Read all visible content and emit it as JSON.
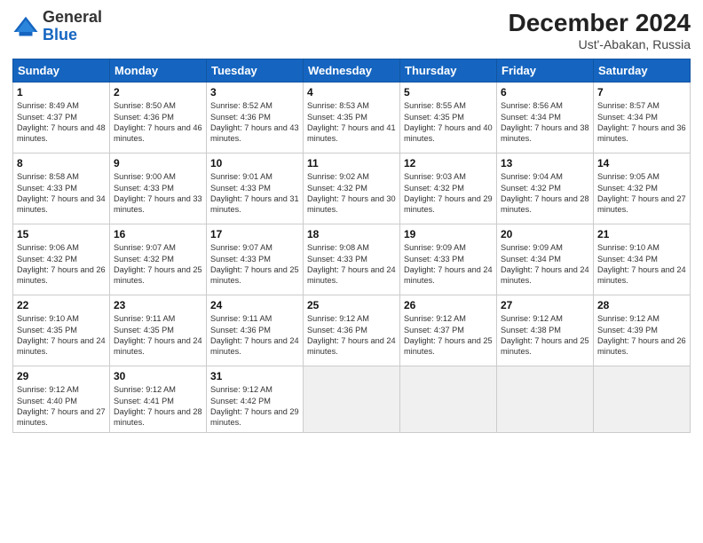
{
  "header": {
    "logo_general": "General",
    "logo_blue": "Blue",
    "month_title": "December 2024",
    "location": "Ust'-Abakan, Russia"
  },
  "weekdays": [
    "Sunday",
    "Monday",
    "Tuesday",
    "Wednesday",
    "Thursday",
    "Friday",
    "Saturday"
  ],
  "weeks": [
    [
      {
        "day": "1",
        "sunrise": "Sunrise: 8:49 AM",
        "sunset": "Sunset: 4:37 PM",
        "daylight": "Daylight: 7 hours and 48 minutes."
      },
      {
        "day": "2",
        "sunrise": "Sunrise: 8:50 AM",
        "sunset": "Sunset: 4:36 PM",
        "daylight": "Daylight: 7 hours and 46 minutes."
      },
      {
        "day": "3",
        "sunrise": "Sunrise: 8:52 AM",
        "sunset": "Sunset: 4:36 PM",
        "daylight": "Daylight: 7 hours and 43 minutes."
      },
      {
        "day": "4",
        "sunrise": "Sunrise: 8:53 AM",
        "sunset": "Sunset: 4:35 PM",
        "daylight": "Daylight: 7 hours and 41 minutes."
      },
      {
        "day": "5",
        "sunrise": "Sunrise: 8:55 AM",
        "sunset": "Sunset: 4:35 PM",
        "daylight": "Daylight: 7 hours and 40 minutes."
      },
      {
        "day": "6",
        "sunrise": "Sunrise: 8:56 AM",
        "sunset": "Sunset: 4:34 PM",
        "daylight": "Daylight: 7 hours and 38 minutes."
      },
      {
        "day": "7",
        "sunrise": "Sunrise: 8:57 AM",
        "sunset": "Sunset: 4:34 PM",
        "daylight": "Daylight: 7 hours and 36 minutes."
      }
    ],
    [
      {
        "day": "8",
        "sunrise": "Sunrise: 8:58 AM",
        "sunset": "Sunset: 4:33 PM",
        "daylight": "Daylight: 7 hours and 34 minutes."
      },
      {
        "day": "9",
        "sunrise": "Sunrise: 9:00 AM",
        "sunset": "Sunset: 4:33 PM",
        "daylight": "Daylight: 7 hours and 33 minutes."
      },
      {
        "day": "10",
        "sunrise": "Sunrise: 9:01 AM",
        "sunset": "Sunset: 4:33 PM",
        "daylight": "Daylight: 7 hours and 31 minutes."
      },
      {
        "day": "11",
        "sunrise": "Sunrise: 9:02 AM",
        "sunset": "Sunset: 4:32 PM",
        "daylight": "Daylight: 7 hours and 30 minutes."
      },
      {
        "day": "12",
        "sunrise": "Sunrise: 9:03 AM",
        "sunset": "Sunset: 4:32 PM",
        "daylight": "Daylight: 7 hours and 29 minutes."
      },
      {
        "day": "13",
        "sunrise": "Sunrise: 9:04 AM",
        "sunset": "Sunset: 4:32 PM",
        "daylight": "Daylight: 7 hours and 28 minutes."
      },
      {
        "day": "14",
        "sunrise": "Sunrise: 9:05 AM",
        "sunset": "Sunset: 4:32 PM",
        "daylight": "Daylight: 7 hours and 27 minutes."
      }
    ],
    [
      {
        "day": "15",
        "sunrise": "Sunrise: 9:06 AM",
        "sunset": "Sunset: 4:32 PM",
        "daylight": "Daylight: 7 hours and 26 minutes."
      },
      {
        "day": "16",
        "sunrise": "Sunrise: 9:07 AM",
        "sunset": "Sunset: 4:32 PM",
        "daylight": "Daylight: 7 hours and 25 minutes."
      },
      {
        "day": "17",
        "sunrise": "Sunrise: 9:07 AM",
        "sunset": "Sunset: 4:33 PM",
        "daylight": "Daylight: 7 hours and 25 minutes."
      },
      {
        "day": "18",
        "sunrise": "Sunrise: 9:08 AM",
        "sunset": "Sunset: 4:33 PM",
        "daylight": "Daylight: 7 hours and 24 minutes."
      },
      {
        "day": "19",
        "sunrise": "Sunrise: 9:09 AM",
        "sunset": "Sunset: 4:33 PM",
        "daylight": "Daylight: 7 hours and 24 minutes."
      },
      {
        "day": "20",
        "sunrise": "Sunrise: 9:09 AM",
        "sunset": "Sunset: 4:34 PM",
        "daylight": "Daylight: 7 hours and 24 minutes."
      },
      {
        "day": "21",
        "sunrise": "Sunrise: 9:10 AM",
        "sunset": "Sunset: 4:34 PM",
        "daylight": "Daylight: 7 hours and 24 minutes."
      }
    ],
    [
      {
        "day": "22",
        "sunrise": "Sunrise: 9:10 AM",
        "sunset": "Sunset: 4:35 PM",
        "daylight": "Daylight: 7 hours and 24 minutes."
      },
      {
        "day": "23",
        "sunrise": "Sunrise: 9:11 AM",
        "sunset": "Sunset: 4:35 PM",
        "daylight": "Daylight: 7 hours and 24 minutes."
      },
      {
        "day": "24",
        "sunrise": "Sunrise: 9:11 AM",
        "sunset": "Sunset: 4:36 PM",
        "daylight": "Daylight: 7 hours and 24 minutes."
      },
      {
        "day": "25",
        "sunrise": "Sunrise: 9:12 AM",
        "sunset": "Sunset: 4:36 PM",
        "daylight": "Daylight: 7 hours and 24 minutes."
      },
      {
        "day": "26",
        "sunrise": "Sunrise: 9:12 AM",
        "sunset": "Sunset: 4:37 PM",
        "daylight": "Daylight: 7 hours and 25 minutes."
      },
      {
        "day": "27",
        "sunrise": "Sunrise: 9:12 AM",
        "sunset": "Sunset: 4:38 PM",
        "daylight": "Daylight: 7 hours and 25 minutes."
      },
      {
        "day": "28",
        "sunrise": "Sunrise: 9:12 AM",
        "sunset": "Sunset: 4:39 PM",
        "daylight": "Daylight: 7 hours and 26 minutes."
      }
    ],
    [
      {
        "day": "29",
        "sunrise": "Sunrise: 9:12 AM",
        "sunset": "Sunset: 4:40 PM",
        "daylight": "Daylight: 7 hours and 27 minutes."
      },
      {
        "day": "30",
        "sunrise": "Sunrise: 9:12 AM",
        "sunset": "Sunset: 4:41 PM",
        "daylight": "Daylight: 7 hours and 28 minutes."
      },
      {
        "day": "31",
        "sunrise": "Sunrise: 9:12 AM",
        "sunset": "Sunset: 4:42 PM",
        "daylight": "Daylight: 7 hours and 29 minutes."
      },
      null,
      null,
      null,
      null
    ]
  ]
}
